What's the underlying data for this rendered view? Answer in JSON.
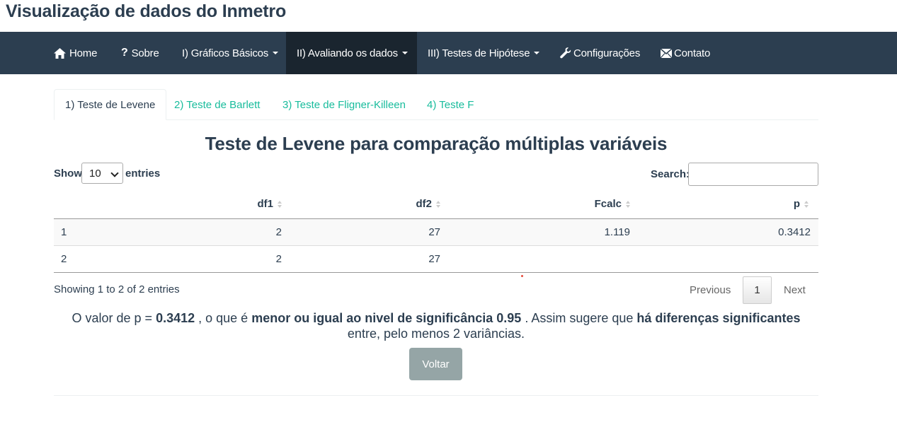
{
  "app": {
    "title": "Visualização de dados do Inmetro"
  },
  "navbar": {
    "items": [
      {
        "label": "Home",
        "icon": "home-icon",
        "dropdown": false
      },
      {
        "label": "Sobre",
        "icon": "question-icon",
        "dropdown": false
      },
      {
        "label": "I) Gráficos Básicos",
        "icon": "",
        "dropdown": true
      },
      {
        "label": "II) Avaliando os dados",
        "icon": "",
        "dropdown": true,
        "active": true
      },
      {
        "label": "III) Testes de Hipótese",
        "icon": "",
        "dropdown": true
      },
      {
        "label": "Configurações",
        "icon": "wrench-icon",
        "dropdown": false
      },
      {
        "label": "Contato",
        "icon": "envelope-icon",
        "dropdown": false
      }
    ]
  },
  "tabs": [
    {
      "label": "1) Teste de Levene",
      "active": true
    },
    {
      "label": "2) Teste de Barlett",
      "active": false
    },
    {
      "label": "3) Teste de Fligner-Killeen",
      "active": false
    },
    {
      "label": "4) Teste F",
      "active": false
    }
  ],
  "main": {
    "heading": "Teste de Levene para comparação múltiplas variáveis"
  },
  "table_controls": {
    "show_label": "Show",
    "entries_value": "10",
    "entries_label": "entries",
    "search_label": "Search:",
    "search_value": ""
  },
  "table": {
    "columns": [
      "",
      "df1",
      "df2",
      "Fcalc",
      "p"
    ],
    "rows": [
      [
        "1",
        "2",
        "27",
        "1.119",
        "0.3412"
      ],
      [
        "2",
        "2",
        "27",
        "",
        ""
      ]
    ]
  },
  "pagination": {
    "info": "Showing 1 to 2 of 2 entries",
    "previous": "Previous",
    "current_page": "1",
    "next": "Next"
  },
  "result": {
    "t1": "O valor de p = ",
    "p_value": "0.3412",
    "t2": " , o que é ",
    "b1": "menor ou igual ao nivel de significância 0.95",
    "t3": " . Assim sugere que ",
    "b2": "há diferenças significantes",
    "t4": " entre, pelo menos 2 variâncias."
  },
  "back_button": {
    "label": "Voltar"
  },
  "colors": {
    "navbar_bg": "#2c3e50",
    "navbar_active": "#1a252f",
    "link_accent": "#18bc9c",
    "button_gray": "#95a5a6"
  }
}
